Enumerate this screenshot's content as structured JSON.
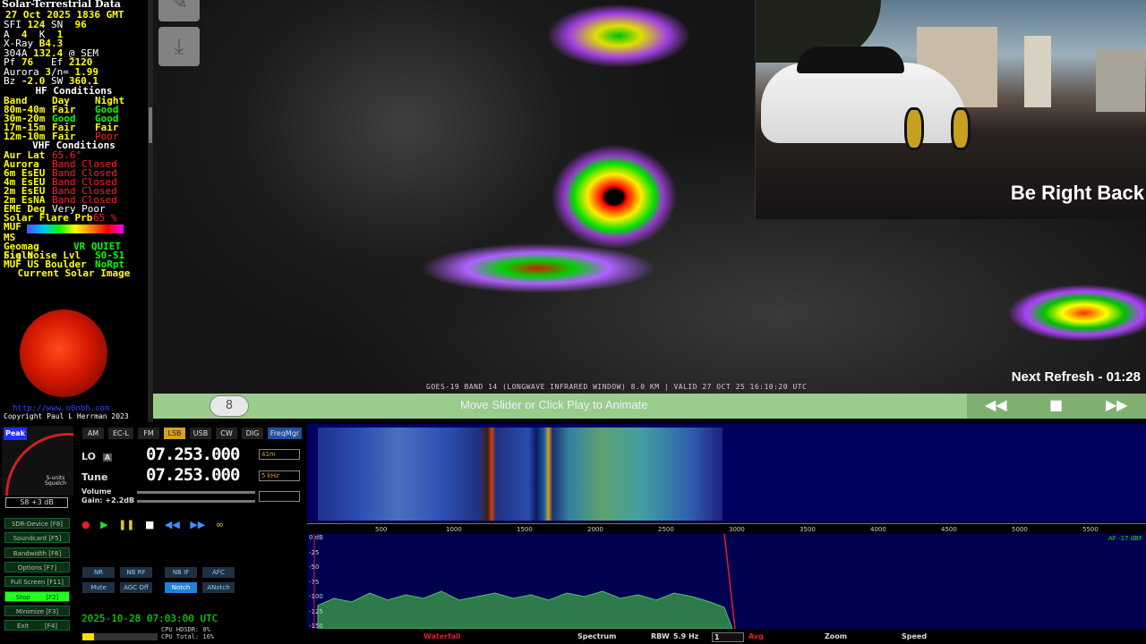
{
  "solar": {
    "title": "Solar-Terrestrial Data",
    "date": "27 Oct 2025 1836 GMT",
    "rows": [
      {
        "a": "SFI ",
        "b": "124",
        "c": " SN  ",
        "d": "96"
      },
      {
        "a": "A  ",
        "b": "4",
        "c": "  K  ",
        "d": "1"
      },
      {
        "a": "X-Ray ",
        "b": "B4.3",
        "c": "",
        "d": ""
      },
      {
        "a": "304A ",
        "b": "132.4",
        "c": " @ SEM",
        "d": ""
      },
      {
        "a": "Pf ",
        "b": "76",
        "c": "   Ef ",
        "d": "2120"
      },
      {
        "a": "Aurora ",
        "b": "3",
        "c": "/n= ",
        "d": "1.99"
      },
      {
        "a": "Bz ",
        "b": "-2.0",
        "c": " SW ",
        "d": "360.1"
      }
    ],
    "hf_title": "HF Conditions",
    "hf_header": [
      "Band",
      "Day",
      "Night"
    ],
    "hf": [
      {
        "band": "80m-40m",
        "day": "Fair",
        "day_c": "cy",
        "night": "Good",
        "night_c": "cg"
      },
      {
        "band": "30m-20m",
        "day": "Good",
        "day_c": "cg",
        "night": "Good",
        "night_c": "cg"
      },
      {
        "band": "17m-15m",
        "day": "Fair",
        "day_c": "cy",
        "night": "Fair",
        "night_c": "cy"
      },
      {
        "band": "12m-10m",
        "day": "Fair",
        "day_c": "cy",
        "night": "Poor",
        "night_c": "cr"
      }
    ],
    "vhf_title": "VHF Conditions",
    "vhf": [
      {
        "name": "Aur Lat",
        "value": "65.6°"
      },
      {
        "name": "Aurora",
        "value": "Band Closed"
      },
      {
        "name": "6m EsEU",
        "value": "Band Closed"
      },
      {
        "name": "4m EsEU",
        "value": "Band Closed"
      },
      {
        "name": "2m EsEU",
        "value": "Band Closed"
      },
      {
        "name": "2m EsNA",
        "value": "Band Closed"
      }
    ],
    "eme_label": "EME Deg",
    "eme_value": "Very Poor",
    "flare_label": "Solar Flare Prb",
    "flare_value": "65 %",
    "muf_label": "MUF",
    "ms_label": "MS",
    "geomag_label": "Geomag Field",
    "geomag_value": "VR QUIET",
    "sig_label": "Sig Noise Lvl",
    "sig_value": "S0-S1",
    "mufus_label": "MUF US Boulder",
    "mufus_value": "NoRpt",
    "solar_image_title": "Current Solar Image",
    "link": "http://www.n0nbh.com",
    "copyright": "Copyright Paul L Herrman 2023"
  },
  "satellite": {
    "caption": "GOES-19 BAND 14 (LONGWAVE INFRARED WINDOW) 8.0 KM | VALID 27 OCT 25 16:10:20 UTC",
    "next_refresh": "Next Refresh - 01:28",
    "download_icon": "download-icon"
  },
  "video": {
    "overlay_text": "Be Right Back"
  },
  "slider": {
    "frame": "8",
    "message": "Move Slider or Click Play to Animate",
    "rewind": "◀◀",
    "stop": "■",
    "forward": "▶▶"
  },
  "sdr": {
    "peak": "Peak",
    "squelch": "S-units Squelch",
    "smeter_readout": "S8 +3 dB",
    "modes": [
      "AM",
      "EC-L",
      "FM",
      "LSB",
      "USB",
      "CW",
      "DIG",
      "FreqMgr"
    ],
    "active_mode": "LSB",
    "lo_label": "LO",
    "lo_badge": "A",
    "lo_freq": "07.253.000",
    "tune_label": "Tune",
    "tune_freq": "07.253.000",
    "band_select": "41m",
    "step_select": "5 kHz",
    "volume_label": "Volume",
    "gain_label": "Gain: +2.2dB",
    "fkeys": [
      {
        "label": "SDR-Device [F8]",
        "on": false
      },
      {
        "label": "Soundcard [F5]",
        "on": false
      },
      {
        "label": "Bandwidth [F6]",
        "on": false
      },
      {
        "label": "Options [F7]",
        "on": false
      },
      {
        "label": "Full Screen [F11]",
        "on": false
      },
      {
        "label": "Stop        [F2]",
        "on": true
      },
      {
        "label": "Minimize [F3]",
        "on": false
      },
      {
        "label": "Exit        [F4]",
        "on": false
      }
    ],
    "dsp_row1": [
      "NR",
      "NB RF",
      "NB IF",
      "AFC"
    ],
    "dsp_row2": [
      "Mute",
      "AGC Off",
      "Notch",
      "ANotch"
    ],
    "datetime": "2025-10-28  07:03:00 UTC",
    "cpu_hdsdr": "CPU HDSDR: 0%",
    "cpu_total": "CPU Total: 16%",
    "cpu_total_fraction": 0.16,
    "axis_ticks": [
      "500",
      "1000",
      "1500",
      "2000",
      "2500",
      "3000",
      "3500",
      "4000",
      "4500",
      "5000",
      "5500"
    ],
    "spectrum_ylabels": [
      "0 dB",
      "-25",
      "-50",
      "-75",
      "-100",
      "-125",
      "-150"
    ],
    "af_level": "AF -17 dBF",
    "bottom": {
      "waterfall": "Waterfall",
      "spectrum": "Spectrum",
      "rbw": "RBW",
      "rbw_value": "5.9 Hz",
      "avg_select": "1",
      "avg": "Avg",
      "zoom": "Zoom",
      "speed": "Speed"
    },
    "colors": {
      "accent": "#d8a020",
      "waterfall_bg": "#000060",
      "spectrum_fill": "#2e7a4a"
    }
  }
}
